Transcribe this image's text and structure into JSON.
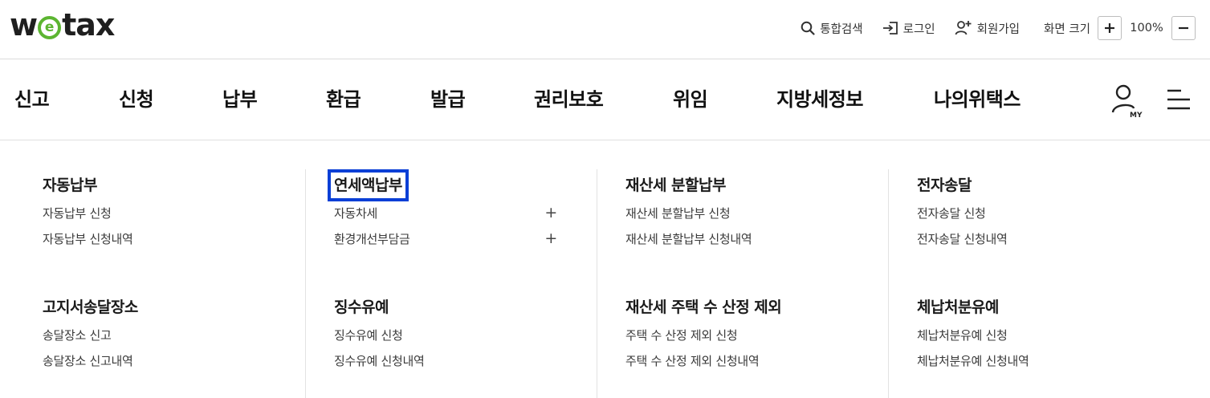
{
  "logo": {
    "prefix": "w",
    "e": "e",
    "suffix": "tax"
  },
  "utility": {
    "search_label": "통합검색",
    "login_label": "로그인",
    "signup_label": "회원가입",
    "zoom_label": "화면 크기",
    "zoom_value": "100%"
  },
  "nav": {
    "items": [
      "신고",
      "신청",
      "납부",
      "환급",
      "발급",
      "권리보호",
      "위임",
      "지방세정보",
      "나의위택스"
    ],
    "my_label": "MY"
  },
  "mega": {
    "columns": [
      {
        "groups": [
          {
            "title": "자동납부",
            "items": [
              "자동납부 신청",
              "자동납부 신청내역"
            ]
          },
          {
            "title": "고지서송달장소",
            "items": [
              "송달장소 신고",
              "송달장소 신고내역"
            ]
          }
        ]
      },
      {
        "groups": [
          {
            "title": "연세액납부",
            "items": [
              "자동차세",
              "환경개선부담금"
            ]
          },
          {
            "title": "징수유예",
            "items": [
              "징수유예 신청",
              "징수유예 신청내역"
            ]
          }
        ]
      },
      {
        "groups": [
          {
            "title": "재산세 분할납부",
            "items": [
              "재산세 분할납부 신청",
              "재산세 분할납부 신청내역"
            ]
          },
          {
            "title": "재산세 주택 수 산정 제외",
            "items": [
              "주택 수 산정 제외 신청",
              "주택 수 산정 제외 신청내역"
            ]
          }
        ]
      },
      {
        "groups": [
          {
            "title": "전자송달",
            "items": [
              "전자송달 신청",
              "전자송달 신청내역"
            ]
          },
          {
            "title": "체납처분유예",
            "items": [
              "체납처분유예 신청",
              "체납처분유예 신청내역"
            ]
          }
        ]
      }
    ],
    "expand_symbol": "+"
  },
  "colors": {
    "brand_green": "#5cb531",
    "focus_outline": "#0a3fd6",
    "divider": "#e2e2e2"
  }
}
